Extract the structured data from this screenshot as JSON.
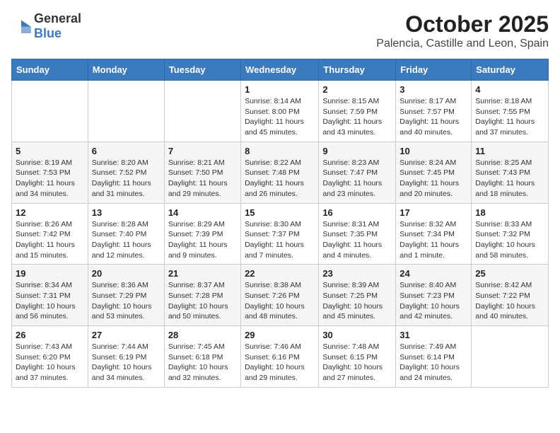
{
  "logo": {
    "general": "General",
    "blue": "Blue"
  },
  "title": "October 2025",
  "subtitle": "Palencia, Castille and Leon, Spain",
  "days_of_week": [
    "Sunday",
    "Monday",
    "Tuesday",
    "Wednesday",
    "Thursday",
    "Friday",
    "Saturday"
  ],
  "weeks": [
    [
      {
        "day": "",
        "info": ""
      },
      {
        "day": "",
        "info": ""
      },
      {
        "day": "",
        "info": ""
      },
      {
        "day": "1",
        "info": "Sunrise: 8:14 AM\nSunset: 8:00 PM\nDaylight: 11 hours and 45 minutes."
      },
      {
        "day": "2",
        "info": "Sunrise: 8:15 AM\nSunset: 7:59 PM\nDaylight: 11 hours and 43 minutes."
      },
      {
        "day": "3",
        "info": "Sunrise: 8:17 AM\nSunset: 7:57 PM\nDaylight: 11 hours and 40 minutes."
      },
      {
        "day": "4",
        "info": "Sunrise: 8:18 AM\nSunset: 7:55 PM\nDaylight: 11 hours and 37 minutes."
      }
    ],
    [
      {
        "day": "5",
        "info": "Sunrise: 8:19 AM\nSunset: 7:53 PM\nDaylight: 11 hours and 34 minutes."
      },
      {
        "day": "6",
        "info": "Sunrise: 8:20 AM\nSunset: 7:52 PM\nDaylight: 11 hours and 31 minutes."
      },
      {
        "day": "7",
        "info": "Sunrise: 8:21 AM\nSunset: 7:50 PM\nDaylight: 11 hours and 29 minutes."
      },
      {
        "day": "8",
        "info": "Sunrise: 8:22 AM\nSunset: 7:48 PM\nDaylight: 11 hours and 26 minutes."
      },
      {
        "day": "9",
        "info": "Sunrise: 8:23 AM\nSunset: 7:47 PM\nDaylight: 11 hours and 23 minutes."
      },
      {
        "day": "10",
        "info": "Sunrise: 8:24 AM\nSunset: 7:45 PM\nDaylight: 11 hours and 20 minutes."
      },
      {
        "day": "11",
        "info": "Sunrise: 8:25 AM\nSunset: 7:43 PM\nDaylight: 11 hours and 18 minutes."
      }
    ],
    [
      {
        "day": "12",
        "info": "Sunrise: 8:26 AM\nSunset: 7:42 PM\nDaylight: 11 hours and 15 minutes."
      },
      {
        "day": "13",
        "info": "Sunrise: 8:28 AM\nSunset: 7:40 PM\nDaylight: 11 hours and 12 minutes."
      },
      {
        "day": "14",
        "info": "Sunrise: 8:29 AM\nSunset: 7:39 PM\nDaylight: 11 hours and 9 minutes."
      },
      {
        "day": "15",
        "info": "Sunrise: 8:30 AM\nSunset: 7:37 PM\nDaylight: 11 hours and 7 minutes."
      },
      {
        "day": "16",
        "info": "Sunrise: 8:31 AM\nSunset: 7:35 PM\nDaylight: 11 hours and 4 minutes."
      },
      {
        "day": "17",
        "info": "Sunrise: 8:32 AM\nSunset: 7:34 PM\nDaylight: 11 hours and 1 minute."
      },
      {
        "day": "18",
        "info": "Sunrise: 8:33 AM\nSunset: 7:32 PM\nDaylight: 10 hours and 58 minutes."
      }
    ],
    [
      {
        "day": "19",
        "info": "Sunrise: 8:34 AM\nSunset: 7:31 PM\nDaylight: 10 hours and 56 minutes."
      },
      {
        "day": "20",
        "info": "Sunrise: 8:36 AM\nSunset: 7:29 PM\nDaylight: 10 hours and 53 minutes."
      },
      {
        "day": "21",
        "info": "Sunrise: 8:37 AM\nSunset: 7:28 PM\nDaylight: 10 hours and 50 minutes."
      },
      {
        "day": "22",
        "info": "Sunrise: 8:38 AM\nSunset: 7:26 PM\nDaylight: 10 hours and 48 minutes."
      },
      {
        "day": "23",
        "info": "Sunrise: 8:39 AM\nSunset: 7:25 PM\nDaylight: 10 hours and 45 minutes."
      },
      {
        "day": "24",
        "info": "Sunrise: 8:40 AM\nSunset: 7:23 PM\nDaylight: 10 hours and 42 minutes."
      },
      {
        "day": "25",
        "info": "Sunrise: 8:42 AM\nSunset: 7:22 PM\nDaylight: 10 hours and 40 minutes."
      }
    ],
    [
      {
        "day": "26",
        "info": "Sunrise: 7:43 AM\nSunset: 6:20 PM\nDaylight: 10 hours and 37 minutes."
      },
      {
        "day": "27",
        "info": "Sunrise: 7:44 AM\nSunset: 6:19 PM\nDaylight: 10 hours and 34 minutes."
      },
      {
        "day": "28",
        "info": "Sunrise: 7:45 AM\nSunset: 6:18 PM\nDaylight: 10 hours and 32 minutes."
      },
      {
        "day": "29",
        "info": "Sunrise: 7:46 AM\nSunset: 6:16 PM\nDaylight: 10 hours and 29 minutes."
      },
      {
        "day": "30",
        "info": "Sunrise: 7:48 AM\nSunset: 6:15 PM\nDaylight: 10 hours and 27 minutes."
      },
      {
        "day": "31",
        "info": "Sunrise: 7:49 AM\nSunset: 6:14 PM\nDaylight: 10 hours and 24 minutes."
      },
      {
        "day": "",
        "info": ""
      }
    ]
  ]
}
